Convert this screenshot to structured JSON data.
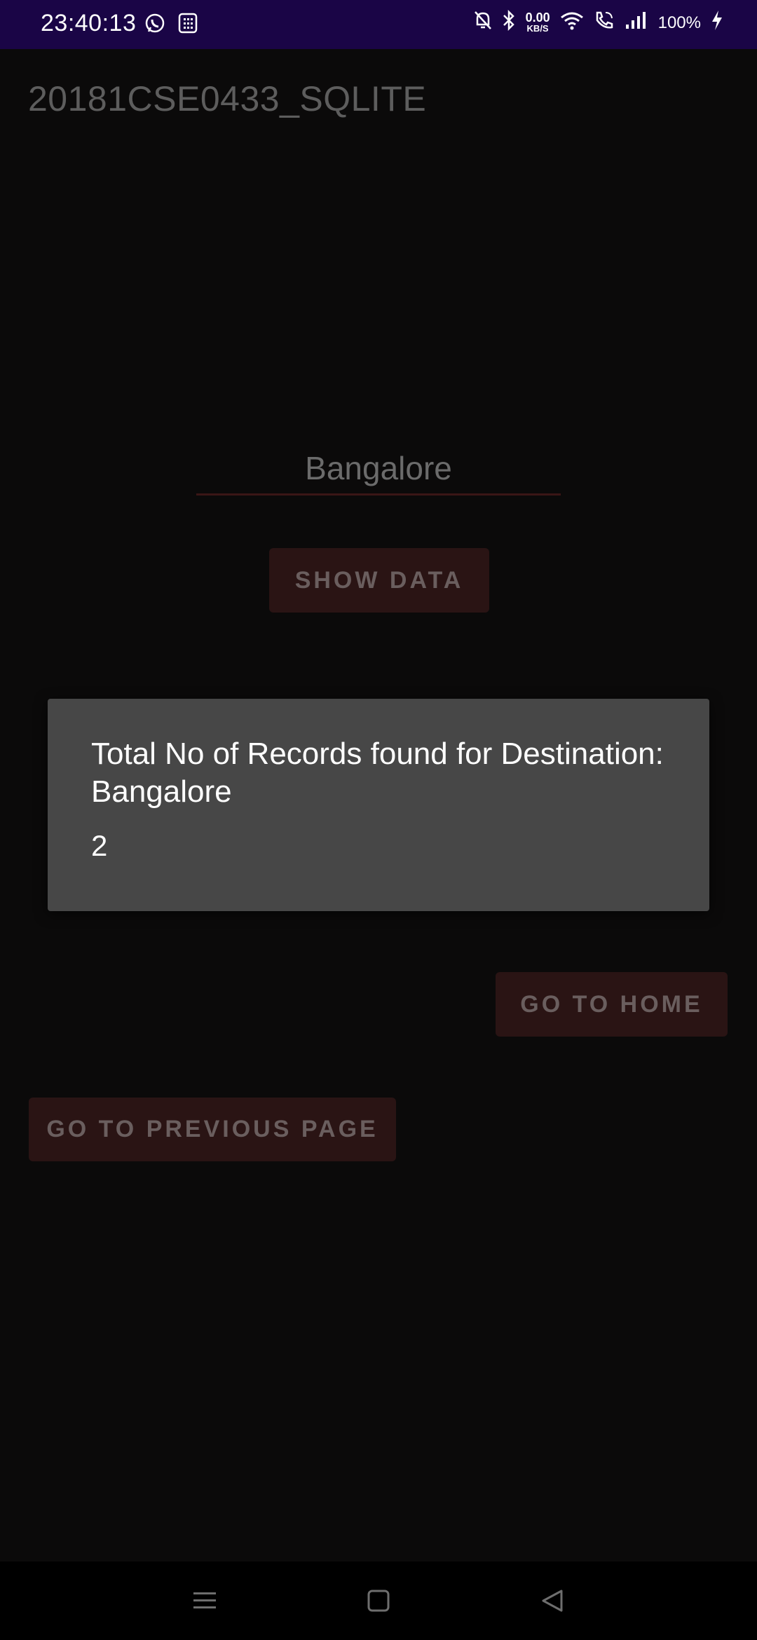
{
  "status_bar": {
    "time": "23:40:13",
    "net_speed_value": "0.00",
    "net_speed_unit": "KB/S",
    "battery": "100%",
    "icons": [
      "whatsapp-icon",
      "calculator-icon",
      "mute-bell-icon",
      "bluetooth-icon",
      "wifi-icon",
      "wifi-call-icon",
      "signal-icon",
      "charging-icon"
    ]
  },
  "app": {
    "title": "20181CSE0433_SQLITE"
  },
  "form": {
    "destination_value": "Bangalore",
    "show_data_label": "SHOW DATA",
    "go_home_label": "GO TO HOME",
    "go_previous_label": "GO TO PREVIOUS PAGE"
  },
  "dialog": {
    "title": "Total No of Records found for Destination: Bangalore",
    "message": "2"
  },
  "nav_bar": {
    "icons": [
      "menu-icon",
      "home-square-icon",
      "back-triangle-icon"
    ]
  },
  "colors": {
    "status_bar_bg": "#1a0546",
    "background": "#0b0a0a",
    "button_bg": "#2a1414",
    "dialog_bg": "#474747"
  }
}
